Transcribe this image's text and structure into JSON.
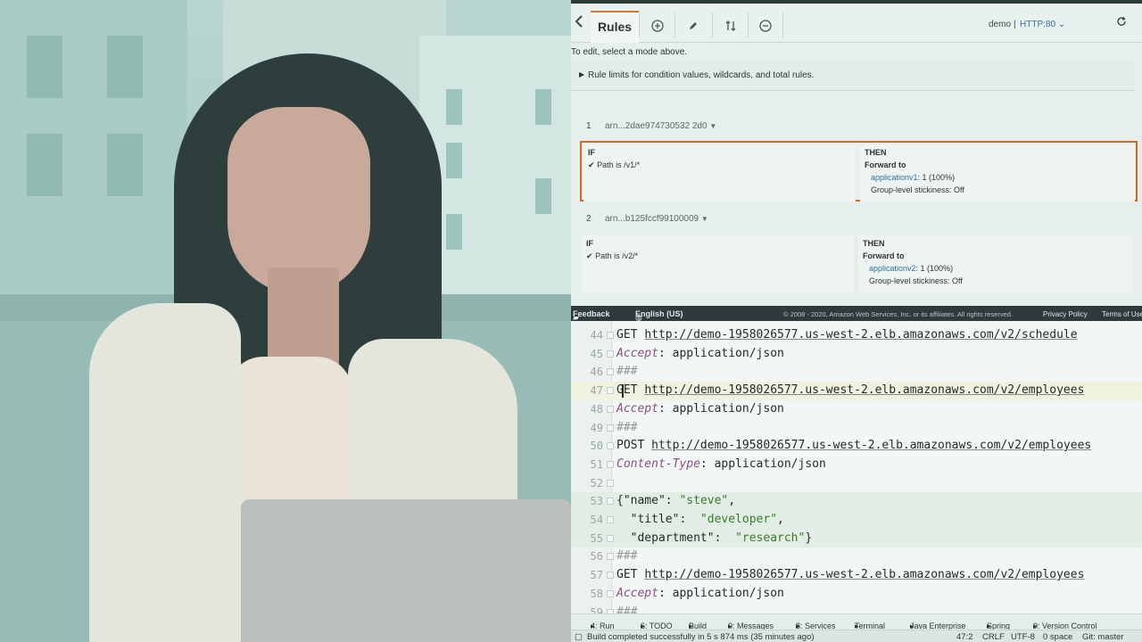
{
  "aws": {
    "toolbar": {
      "tab_label": "Rules",
      "add_icon": "plus-circle-icon",
      "edit_icon": "pencil-icon",
      "reorder_icon": "reorder-icon",
      "delete_icon": "minus-circle-icon",
      "lb_name": "demo",
      "listener": "HTTP:80",
      "refresh_icon": "refresh-icon"
    },
    "hint": "To edit, select a mode above.",
    "limits_label": "Rule limits for condition values, wildcards, and total rules.",
    "rules": [
      {
        "number": "1",
        "arn": "arn...2dae974730532 2d0",
        "if_label": "IF",
        "condition": "Path is /v1/*",
        "then_label": "THEN",
        "action": "Forward to",
        "target_name": "applicationv1",
        "target_weight": ": 1 (100%)",
        "stickiness": "Group-level stickiness: Off"
      },
      {
        "number": "2",
        "arn": "arn...b125fccf99100009",
        "if_label": "IF",
        "condition": "Path is /v2/*",
        "then_label": "THEN",
        "action": "Forward to",
        "target_name": "applicationv2",
        "target_weight": ": 1 (100%)",
        "stickiness": "Group-level stickiness: Off"
      }
    ],
    "footer": {
      "feedback": "Feedback",
      "language": "English (US)",
      "copyright": "© 2008 - 2020, Amazon Web Services, Inc. or its affiliates. All rights reserved.",
      "privacy": "Privacy Policy",
      "terms": "Terms of Use"
    }
  },
  "editor": {
    "lines": [
      {
        "n": "44",
        "parts": [
          [
            "kw",
            "GET "
          ],
          [
            "url",
            "http://demo-1958026577.us-west-2.elb.amazonaws.com/v2/schedule"
          ]
        ]
      },
      {
        "n": "45",
        "parts": [
          [
            "hdr",
            "Accept"
          ],
          [
            "kw",
            ": application/json"
          ]
        ]
      },
      {
        "n": "46",
        "parts": [
          [
            "cmt",
            "###"
          ]
        ]
      },
      {
        "n": "47",
        "parts": [
          [
            "kw",
            "GET "
          ],
          [
            "url",
            "http://demo-1958026577.us-west-2.elb.amazonaws.com/v2/employees"
          ]
        ],
        "current": true
      },
      {
        "n": "48",
        "parts": [
          [
            "hdr",
            "Accept"
          ],
          [
            "kw",
            ": application/json"
          ]
        ]
      },
      {
        "n": "49",
        "parts": [
          [
            "cmt",
            "###"
          ]
        ]
      },
      {
        "n": "50",
        "parts": [
          [
            "kw",
            "POST "
          ],
          [
            "url",
            "http://demo-1958026577.us-west-2.elb.amazonaws.com/v2/employees"
          ]
        ]
      },
      {
        "n": "51",
        "parts": [
          [
            "hdr",
            "Content-Type"
          ],
          [
            "kw",
            ": application/json"
          ]
        ]
      },
      {
        "n": "52",
        "parts": []
      },
      {
        "n": "53",
        "parts": [
          [
            "kw",
            "{\"name\": "
          ],
          [
            "str",
            "\"steve\""
          ],
          [
            "kw",
            ","
          ]
        ],
        "hl": true
      },
      {
        "n": "54",
        "parts": [
          [
            "kw",
            "  \"title\":  "
          ],
          [
            "str",
            "\"developer\""
          ],
          [
            "kw",
            ","
          ]
        ],
        "hl": true
      },
      {
        "n": "55",
        "parts": [
          [
            "kw",
            "  \"department\":  "
          ],
          [
            "str",
            "\"research\""
          ],
          [
            "kw",
            "}"
          ]
        ],
        "hl": true
      },
      {
        "n": "56",
        "parts": [
          [
            "cmt",
            "###"
          ]
        ]
      },
      {
        "n": "57",
        "parts": [
          [
            "kw",
            "GET "
          ],
          [
            "url",
            "http://demo-1958026577.us-west-2.elb.amazonaws.com/v2/employees"
          ]
        ]
      },
      {
        "n": "58",
        "parts": [
          [
            "hdr",
            "Accept"
          ],
          [
            "kw",
            ": application/json"
          ]
        ]
      },
      {
        "n": "59",
        "parts": [
          [
            "cmt",
            "###"
          ]
        ]
      }
    ]
  },
  "tool_windows": [
    "4: Run",
    "6: TODO",
    "Build",
    "0: Messages",
    "8: Services",
    "Terminal",
    "Java Enterprise",
    "Spring",
    "9: Version Control"
  ],
  "status": {
    "message": "Build completed successfully in 5 s 874 ms (35 minutes ago)",
    "position": "47:2",
    "line_sep": "CRLF",
    "encoding": "UTF-8",
    "indent": "0 space",
    "branch": "Git: master"
  }
}
